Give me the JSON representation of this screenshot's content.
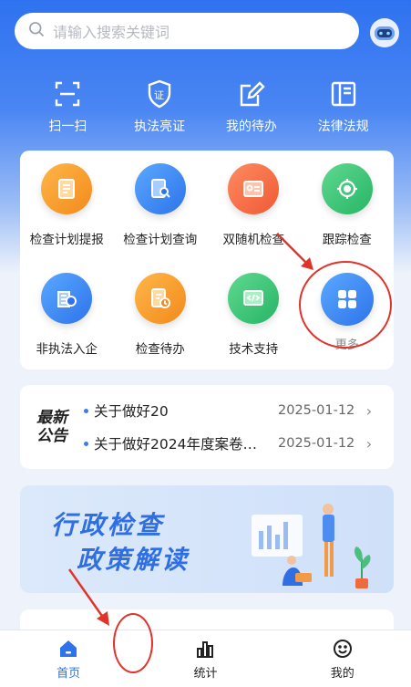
{
  "search": {
    "placeholder": "请输入搜索关键词"
  },
  "colors": {
    "primary": "#2e73ea",
    "annotation": "#e0342b"
  },
  "quick_actions": [
    {
      "label": "扫一扫",
      "icon": "scan-icon"
    },
    {
      "label": "执法亮证",
      "icon": "certificate-shield-icon"
    },
    {
      "label": "我的待办",
      "icon": "todo-edit-icon"
    },
    {
      "label": "法律法规",
      "icon": "law-book-icon"
    }
  ],
  "grid": [
    {
      "label": "检查计划提报",
      "icon": "report-icon"
    },
    {
      "label": "检查计划查询",
      "icon": "search-document-icon"
    },
    {
      "label": "双随机检查",
      "icon": "id-card-icon"
    },
    {
      "label": "跟踪检查",
      "icon": "target-icon"
    },
    {
      "label": "非执法入企",
      "icon": "enterprise-icon"
    },
    {
      "label": "检查待办",
      "icon": "pending-icon"
    },
    {
      "label": "技术支持",
      "icon": "code-icon"
    },
    {
      "label": "更多",
      "icon": "more-grid-icon"
    }
  ],
  "notice": {
    "logo_line1": "最新",
    "logo_line2": "公告",
    "items": [
      {
        "text": "关于做好20",
        "date": "2025-01-12"
      },
      {
        "text": "关于做好2024年度案卷…",
        "date": "2025-01-12"
      }
    ]
  },
  "banner": {
    "line1": "行政检查",
    "line2": "政策解读"
  },
  "tabs": [
    {
      "label": "首页",
      "icon": "home-icon",
      "active": true
    },
    {
      "label": "统计",
      "icon": "bar-chart-icon",
      "active": false
    },
    {
      "label": "我的",
      "icon": "smile-icon",
      "active": false
    }
  ]
}
